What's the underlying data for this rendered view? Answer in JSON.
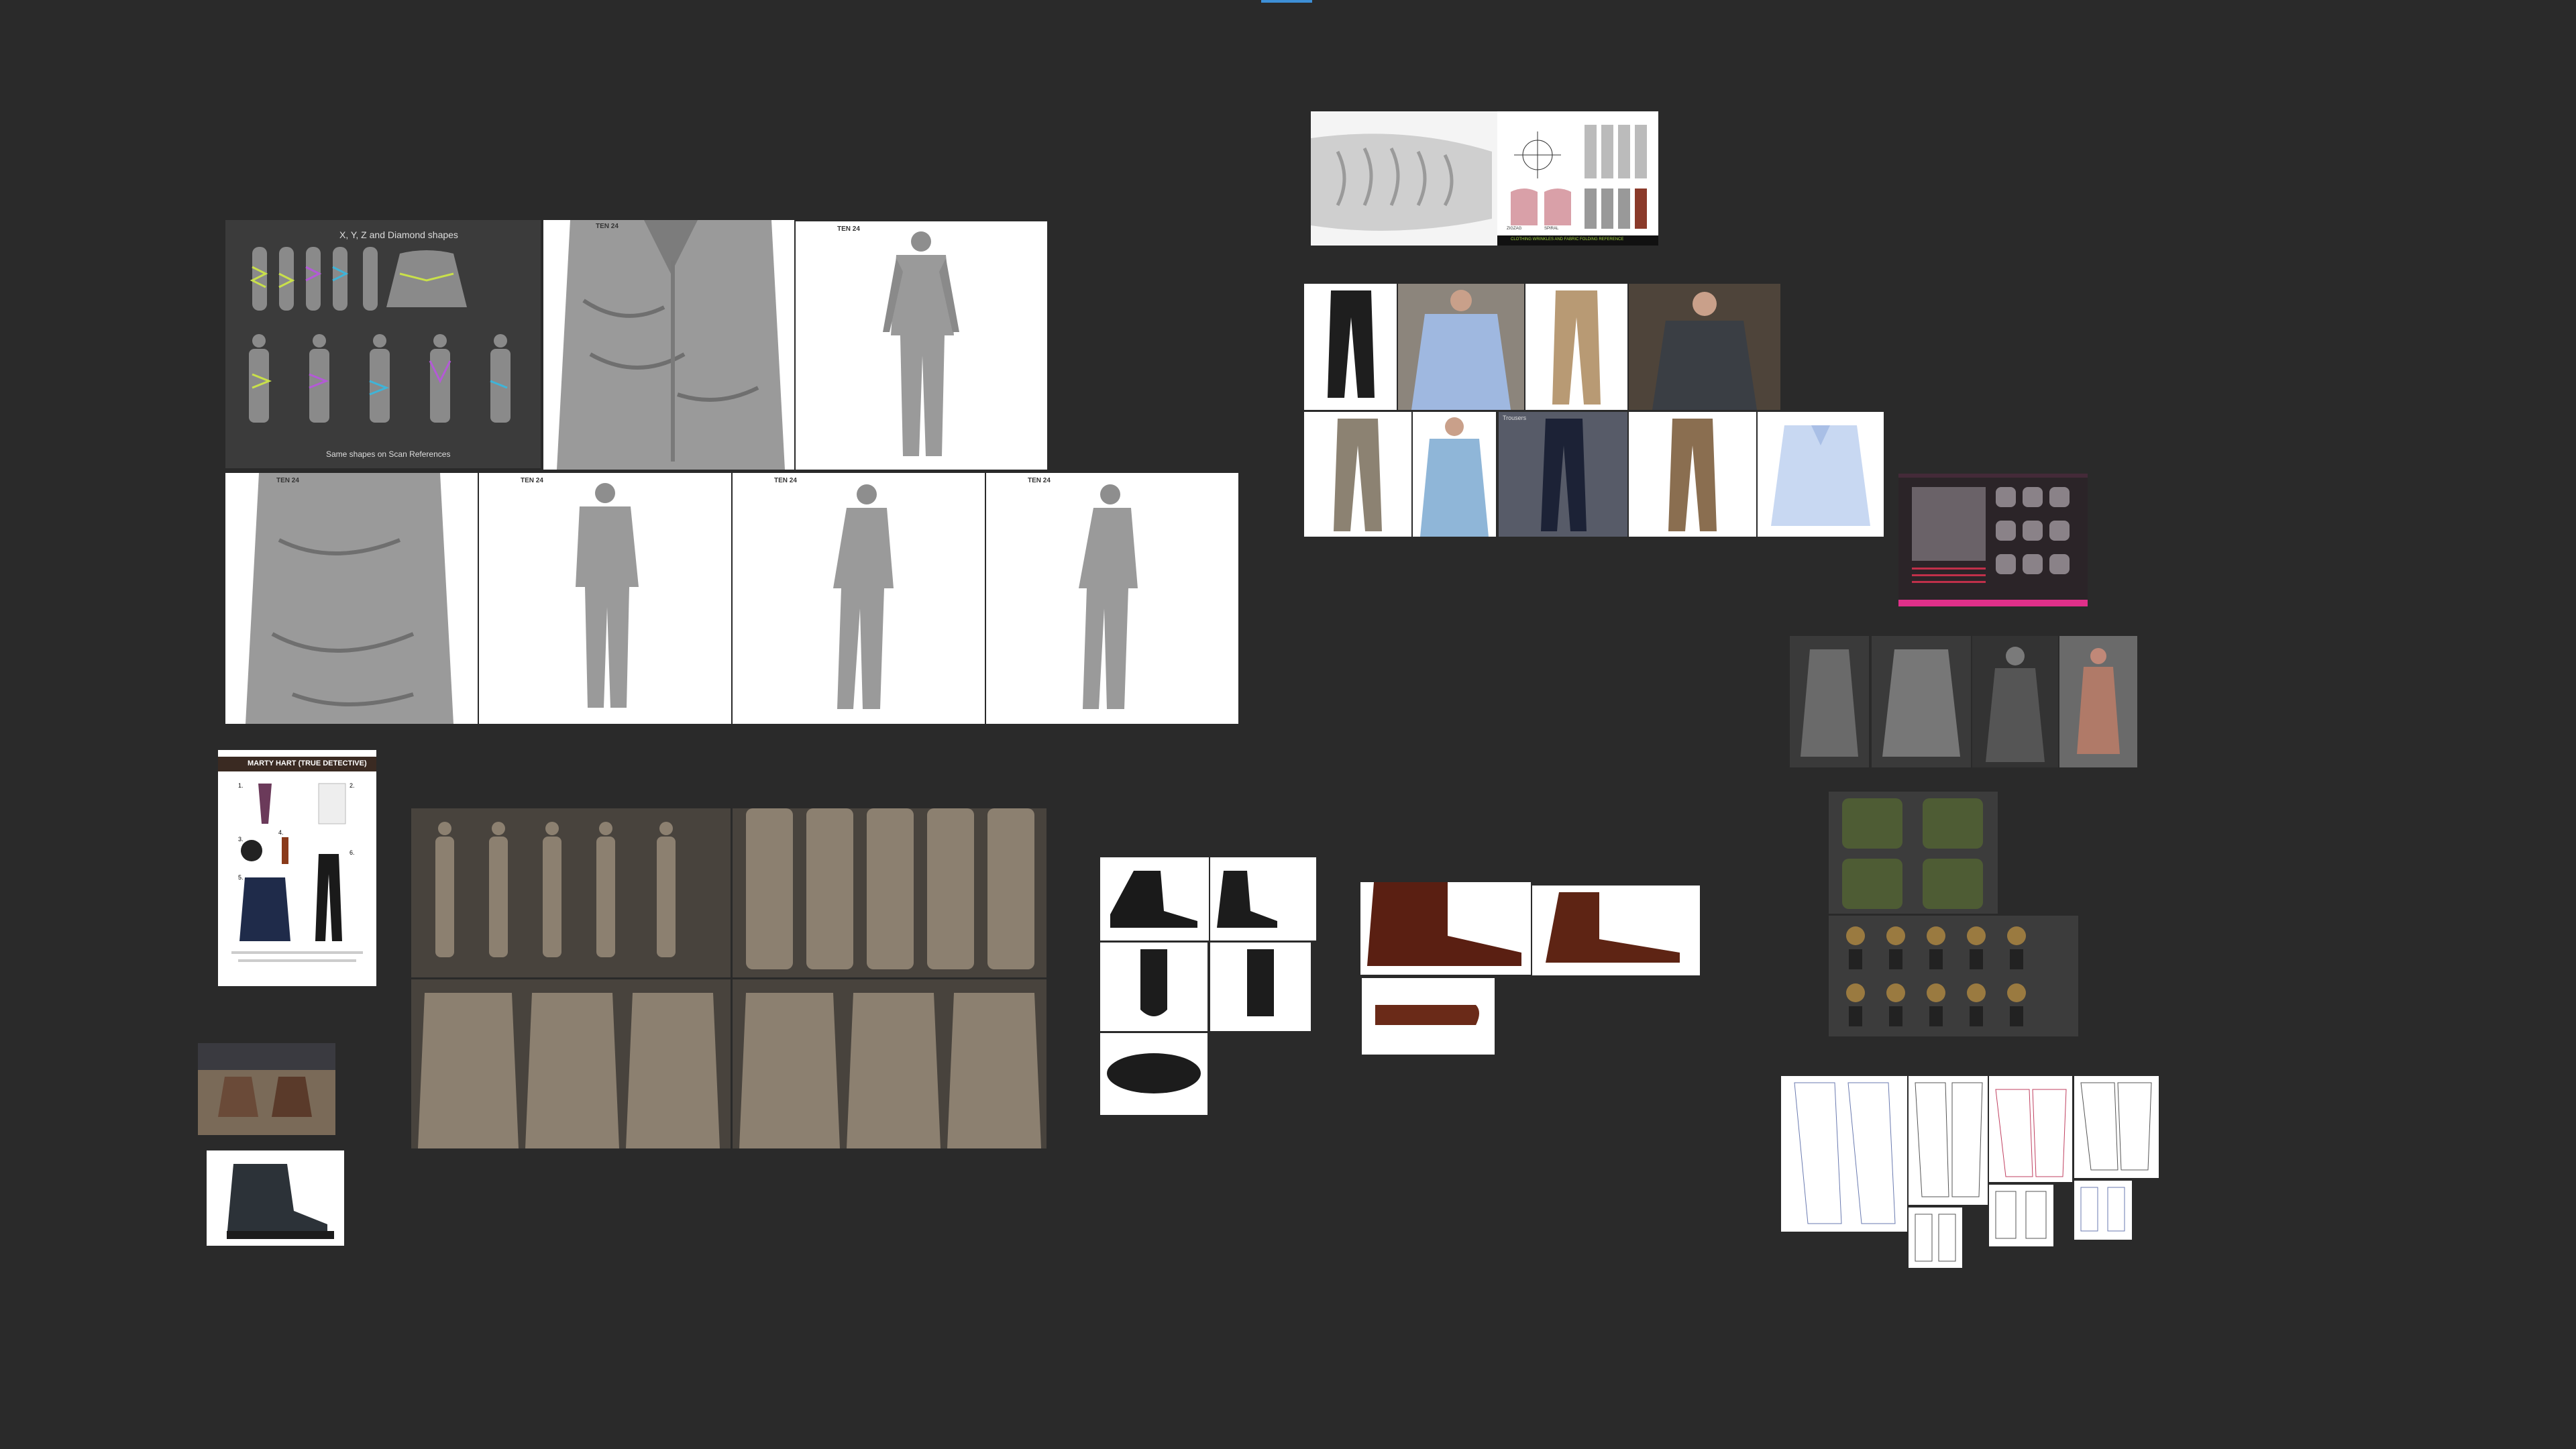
{
  "board": {
    "background": "#2a2a2a",
    "accent": "#3d8fd6"
  },
  "scan_sheet": {
    "title": "X, Y, Z and Diamond shapes",
    "caption": "Same shapes on Scan References"
  },
  "ten24_logo": "TEN 24",
  "marty_hart": {
    "title": "MARTY HART (TRUE DETECTIVE)",
    "numbers": [
      "1.",
      "2.",
      "3.",
      "4.",
      "5.",
      "6."
    ]
  },
  "fold_chart": {
    "left_labels": [
      "ZIGZAG",
      "SPIRAL"
    ],
    "footer": "CLOTHING WRINKLES AND FABRIC FOLDING REFERENCE"
  },
  "pants_card": {
    "label": "Trousers"
  },
  "colors": {
    "scan_grey": "#9a9a9a",
    "clay": "#8c8070",
    "leather_brown": "#5a1f12",
    "pink_bar": "#e0308a"
  }
}
